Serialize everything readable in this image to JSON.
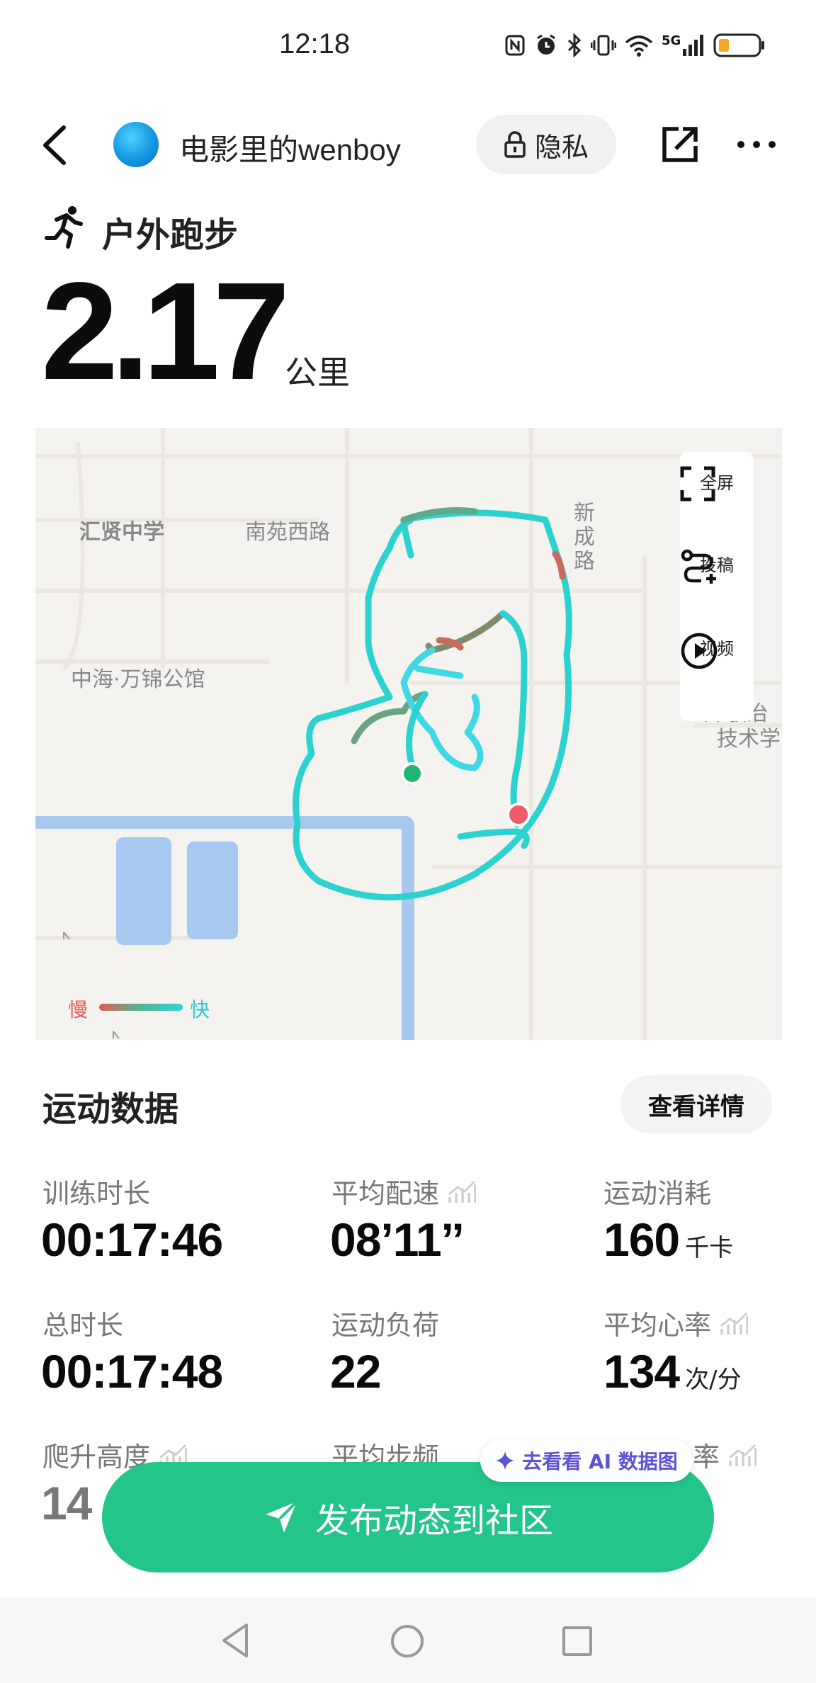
{
  "status_bar": {
    "time": "12:18",
    "network": "5G"
  },
  "header": {
    "user_name": "电影里的wenboy",
    "privacy_label": "隐私"
  },
  "activity": {
    "type": "户外跑步",
    "distance": "2.17",
    "distance_unit": "公里"
  },
  "map": {
    "labels": {
      "school": "汇贤中学",
      "road_west": "南苑西路",
      "road_xincheng": "新成路",
      "residence": "中海·万锦公馆",
      "partial_1": "郑敬治",
      "partial_2": "技术学"
    },
    "tools": [
      {
        "label": "全屏",
        "icon": "fullscreen-icon"
      },
      {
        "label": "投稿",
        "icon": "route-submit-icon"
      },
      {
        "label": "视频",
        "icon": "play-video-icon"
      }
    ],
    "legend": {
      "slow": "慢",
      "fast": "快"
    },
    "colors": {
      "slow": "#e15a5a",
      "mid": "#5bb08a",
      "fast": "#2fd3d8",
      "start": "#22b573",
      "end": "#f05a6a"
    }
  },
  "stats": {
    "title": "运动数据",
    "details_button": "查看详情",
    "items": {
      "training_duration": {
        "label": "训练时长",
        "value": "00:17:46"
      },
      "avg_pace": {
        "label": "平均配速",
        "value": "08’11’’"
      },
      "calories": {
        "label": "运动消耗",
        "value": "160",
        "unit": "千卡"
      },
      "total_duration": {
        "label": "总时长",
        "value": "00:17:48"
      },
      "training_load": {
        "label": "运动负荷",
        "value": "22"
      },
      "avg_heart_rate": {
        "label": "平均心率",
        "value": "134",
        "unit": "次/分"
      },
      "elevation_gain": {
        "label": "爬升高度",
        "value": "14"
      },
      "avg_cadence": {
        "label": "平均步频"
      },
      "partial_rate": {
        "label": "率"
      }
    }
  },
  "ai_chip": {
    "label": "去看看 AI 数据图"
  },
  "publish_button": {
    "label": "发布动态到社区"
  },
  "colors": {
    "accent": "#23c58a",
    "ai": "#5b53d6"
  }
}
